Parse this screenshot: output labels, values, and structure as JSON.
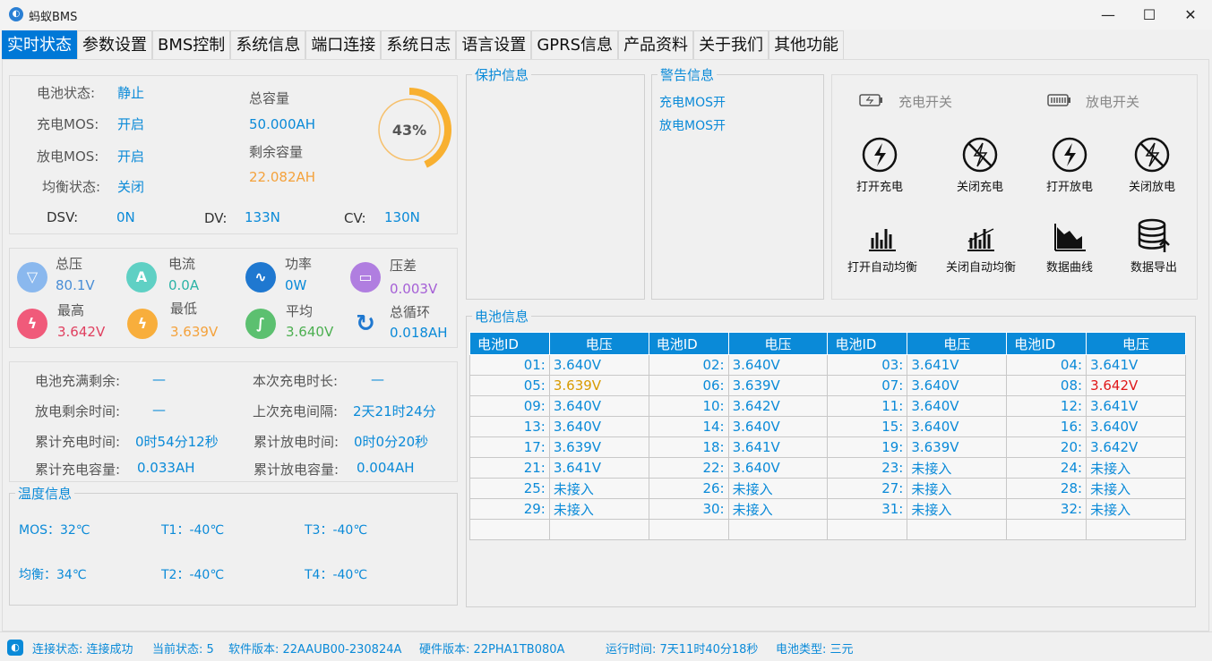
{
  "window": {
    "title": "蚂蚁BMS",
    "minimize": "—",
    "maximize": "☐",
    "close": "✕"
  },
  "tabs": [
    "实时状态",
    "参数设置",
    "BMS控制",
    "系统信息",
    "端口连接",
    "系统日志",
    "语言设置",
    "GPRS信息",
    "产品资料",
    "关于我们",
    "其他功能"
  ],
  "status": {
    "battery_state_label": "电池状态:",
    "battery_state": "静止",
    "charge_mos_label": "充电MOS:",
    "charge_mos": "开启",
    "discharge_mos_label": "放电MOS:",
    "discharge_mos": "开启",
    "balance_label": "均衡状态:",
    "balance": "关闭",
    "total_capacity_label": "总容量",
    "total_capacity": "50.000AH",
    "remaining_capacity_label": "剩余容量",
    "remaining_capacity": "22.082AH",
    "soc_text": "43%",
    "soc_value": 43,
    "dsv_label": "DSV:",
    "dsv": "0N",
    "dv_label": "DV:",
    "dv": "133N",
    "cv_label": "CV:",
    "cv": "130N"
  },
  "metrics": {
    "total_voltage_label": "总压",
    "total_voltage": "80.1V",
    "current_label": "电流",
    "current": "0.0A",
    "power_label": "功率",
    "power": "0W",
    "pressure_diff_label": "压差",
    "pressure_diff": "0.003V",
    "highest_label": "最高",
    "highest": "3.642V",
    "lowest_label": "最低",
    "lowest": "3.639V",
    "average_label": "平均",
    "average": "3.640V",
    "cycles_label": "总循环",
    "cycles": "0.018AH"
  },
  "time_info": {
    "full_remaining_label": "电池充满剩余:",
    "full_remaining": "—",
    "charge_duration_label": "本次充电时长:",
    "charge_duration": "—",
    "discharge_remaining_label": "放电剩余时间:",
    "discharge_remaining": "—",
    "last_charge_interval_label": "上次充电间隔:",
    "last_charge_interval": "2天21时24分",
    "total_charge_time_label": "累计充电时间:",
    "total_charge_time": "0时54分12秒",
    "total_discharge_time_label": "累计放电时间:",
    "total_discharge_time": "0时0分20秒",
    "total_charge_cap_label": "累计充电容量:",
    "total_charge_cap": "0.033AH",
    "total_discharge_cap_label": "累计放电容量:",
    "total_discharge_cap": "0.004AH"
  },
  "temperature": {
    "title": "温度信息",
    "mos": "MOS：32℃",
    "t1": "T1：-40℃",
    "t3": "T3：-40℃",
    "balance": "均衡：34℃",
    "t2": "T2：-40℃",
    "t4": "T4：-40℃"
  },
  "protection": {
    "title": "保护信息"
  },
  "warning": {
    "title": "警告信息",
    "items": [
      "充电MOS开",
      "放电MOS开"
    ]
  },
  "controls": {
    "charge_switch": "充电开关",
    "discharge_switch": "放电开关",
    "open_charge": "打开充电",
    "close_charge": "关闭充电",
    "open_discharge": "打开放电",
    "close_discharge": "关闭放电",
    "open_auto_balance": "打开自动均衡",
    "close_auto_balance": "关闭自动均衡",
    "data_curve": "数据曲线",
    "data_export": "数据导出"
  },
  "cells": {
    "title": "电池信息",
    "header_id": "电池ID",
    "header_v": "电压",
    "rows": [
      [
        [
          "01:",
          "3.640V",
          ""
        ],
        [
          "02:",
          "3.640V",
          ""
        ],
        [
          "03:",
          "3.641V",
          ""
        ],
        [
          "04:",
          "3.641V",
          ""
        ]
      ],
      [
        [
          "05:",
          "3.639V",
          "min"
        ],
        [
          "06:",
          "3.639V",
          ""
        ],
        [
          "07:",
          "3.640V",
          ""
        ],
        [
          "08:",
          "3.642V",
          "max"
        ]
      ],
      [
        [
          "09:",
          "3.640V",
          ""
        ],
        [
          "10:",
          "3.642V",
          ""
        ],
        [
          "11:",
          "3.640V",
          ""
        ],
        [
          "12:",
          "3.641V",
          ""
        ]
      ],
      [
        [
          "13:",
          "3.640V",
          ""
        ],
        [
          "14:",
          "3.640V",
          ""
        ],
        [
          "15:",
          "3.640V",
          ""
        ],
        [
          "16:",
          "3.640V",
          ""
        ]
      ],
      [
        [
          "17:",
          "3.639V",
          ""
        ],
        [
          "18:",
          "3.641V",
          ""
        ],
        [
          "19:",
          "3.639V",
          ""
        ],
        [
          "20:",
          "3.642V",
          ""
        ]
      ],
      [
        [
          "21:",
          "3.641V",
          ""
        ],
        [
          "22:",
          "3.640V",
          ""
        ],
        [
          "23:",
          " 未接入",
          ""
        ],
        [
          "24:",
          " 未接入",
          ""
        ]
      ],
      [
        [
          "25:",
          " 未接入",
          ""
        ],
        [
          "26:",
          " 未接入",
          ""
        ],
        [
          "27:",
          " 未接入",
          ""
        ],
        [
          "28:",
          " 未接入",
          ""
        ]
      ],
      [
        [
          "29:",
          " 未接入",
          ""
        ],
        [
          "30:",
          " 未接入",
          ""
        ],
        [
          "31:",
          " 未接入",
          ""
        ],
        [
          "32:",
          " 未接入",
          ""
        ]
      ],
      [
        [
          "",
          "",
          ""
        ],
        [
          "",
          "",
          ""
        ],
        [
          "",
          "",
          ""
        ],
        [
          "",
          "",
          ""
        ]
      ]
    ]
  },
  "statusbar": {
    "connection": "连接状态:  连接成功",
    "current_state": "当前状态:  5",
    "software": "软件版本:  22AAUB00-230824A",
    "hardware": "硬件版本:  22PHA1TB080A",
    "runtime": "运行时间:  7天11时40分18秒",
    "battery_type": "电池类型:  三元"
  }
}
